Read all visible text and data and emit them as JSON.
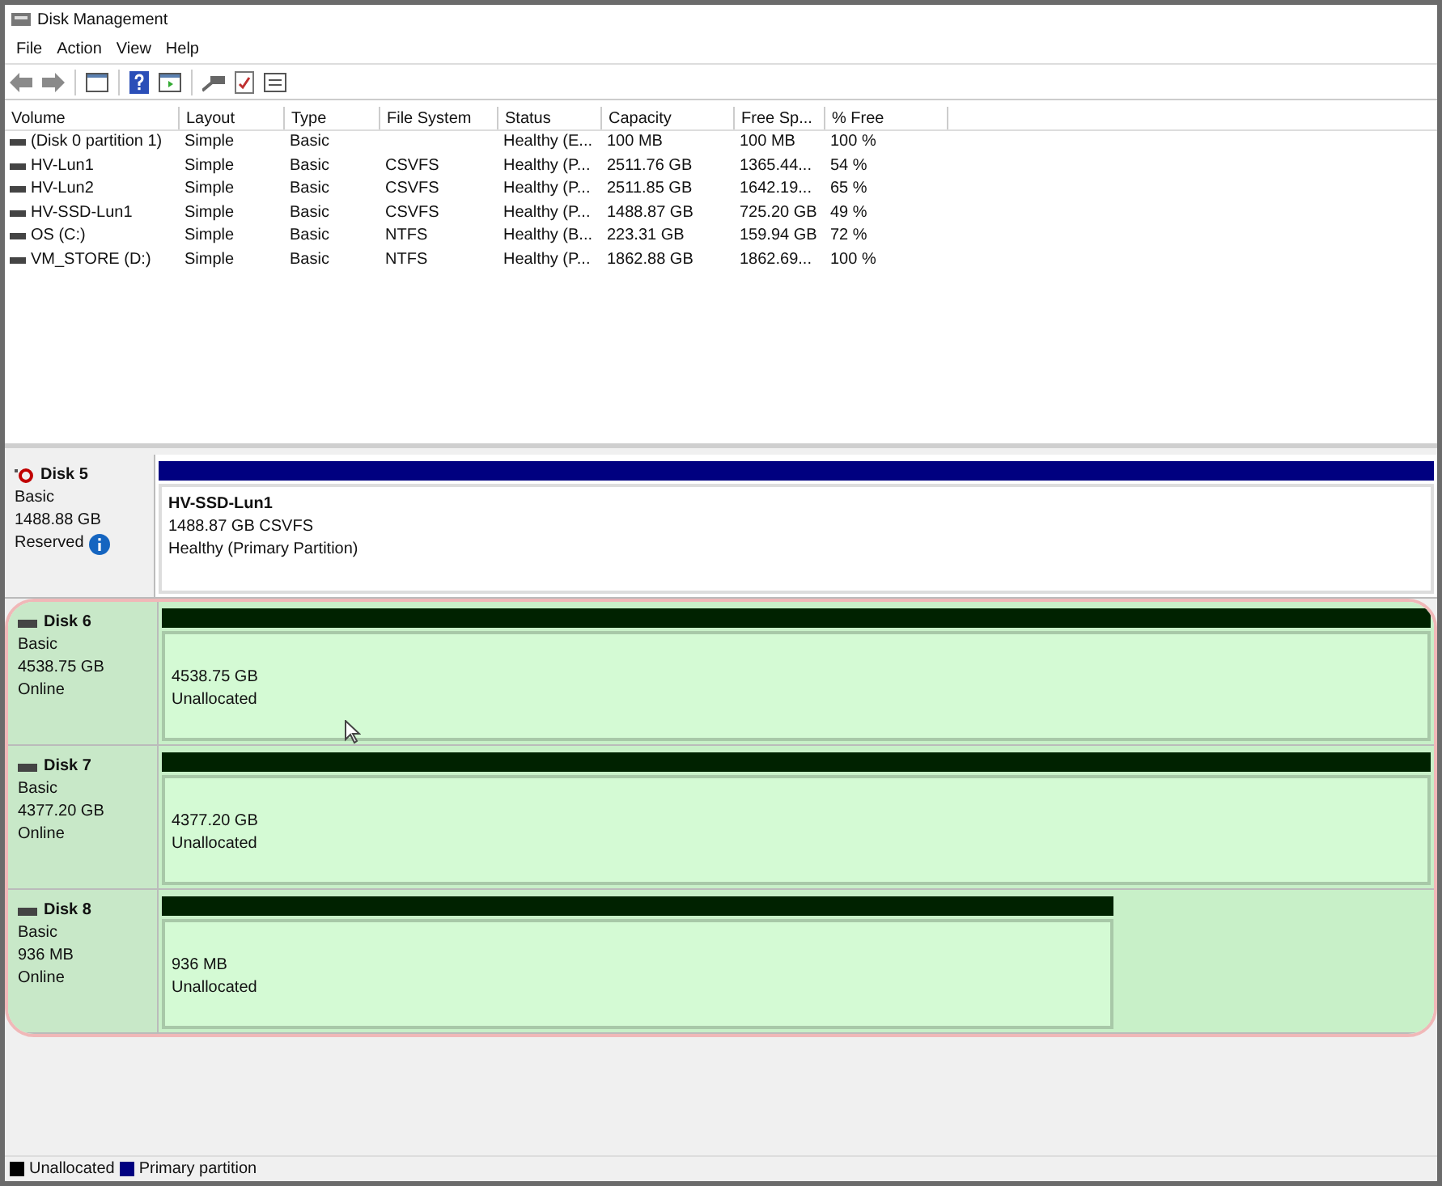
{
  "window": {
    "title": "Disk Management"
  },
  "menu": [
    "File",
    "Action",
    "View",
    "Help"
  ],
  "table": {
    "columns": [
      "Volume",
      "Layout",
      "Type",
      "File System",
      "Status",
      "Capacity",
      "Free Sp...",
      "% Free"
    ],
    "rows": [
      [
        "(Disk 0 partition 1)",
        "Simple",
        "Basic",
        "",
        "Healthy (E...",
        "100 MB",
        "100 MB",
        "100 %"
      ],
      [
        "HV-Lun1",
        "Simple",
        "Basic",
        "CSVFS",
        "Healthy (P...",
        "2511.76 GB",
        "1365.44...",
        "54 %"
      ],
      [
        "HV-Lun2",
        "Simple",
        "Basic",
        "CSVFS",
        "Healthy (P...",
        "2511.85 GB",
        "1642.19...",
        "65 %"
      ],
      [
        "HV-SSD-Lun1",
        "Simple",
        "Basic",
        "CSVFS",
        "Healthy (P...",
        "1488.87 GB",
        "725.20 GB",
        "49 %"
      ],
      [
        "OS (C:)",
        "Simple",
        "Basic",
        "NTFS",
        "Healthy (B...",
        "223.31 GB",
        "159.94 GB",
        "72 %"
      ],
      [
        "VM_STORE (D:)",
        "Simple",
        "Basic",
        "NTFS",
        "Healthy (P...",
        "1862.88 GB",
        "1862.69...",
        "100 %"
      ]
    ]
  },
  "disks": [
    {
      "name": "Disk 5",
      "kind": "reserved",
      "type": "Basic",
      "size": "1488.88 GB",
      "status": "Reserved",
      "highlighted": false,
      "small": false,
      "partition": {
        "kind": "primary",
        "name": "HV-SSD-Lun1",
        "size": "1488.87 GB CSVFS",
        "status": "Healthy (Primary Partition)"
      }
    },
    {
      "name": "Disk 6",
      "kind": "online",
      "type": "Basic",
      "size": "4538.75 GB",
      "status": "Online",
      "highlighted": true,
      "small": false,
      "partition": {
        "kind": "unallocated",
        "size": "4538.75 GB",
        "status": "Unallocated"
      }
    },
    {
      "name": "Disk 7",
      "kind": "online",
      "type": "Basic",
      "size": "4377.20 GB",
      "status": "Online",
      "highlighted": true,
      "small": false,
      "partition": {
        "kind": "unallocated",
        "size": "4377.20 GB",
        "status": "Unallocated"
      }
    },
    {
      "name": "Disk 8",
      "kind": "online",
      "type": "Basic",
      "size": "936 MB",
      "status": "Online",
      "highlighted": true,
      "small": true,
      "partition": {
        "kind": "unallocated",
        "size": "936 MB",
        "status": "Unallocated"
      }
    }
  ],
  "legend": [
    {
      "label": "Unallocated",
      "color": "#000000"
    },
    {
      "label": "Primary partition",
      "color": "#000080"
    }
  ]
}
